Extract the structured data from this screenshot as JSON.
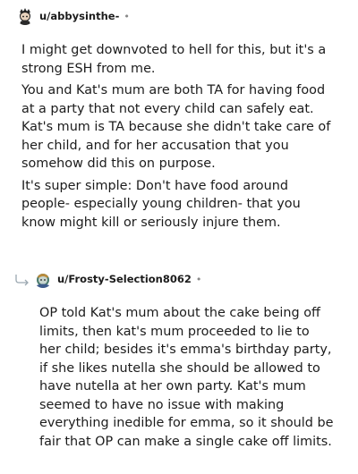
{
  "comment1": {
    "username": "u/abbysinthe-",
    "separator": "•",
    "paragraphs": [
      "I might get downvoted to hell for this, but it's a strong ESH from me.",
      "You and Kat's mum are both TA for having food at a party that not every child can safely eat. Kat's mum is TA because she didn't take care of her child, and for her accusation that you somehow did this on purpose.",
      "It's super simple: Don't have food around people- especially young children- that you know might kill or seriously injure them."
    ]
  },
  "comment2": {
    "username": "u/Frosty-Selection8062",
    "separator": "•",
    "paragraphs": [
      "OP told Kat's mum about the cake being off limits, then kat's mum proceeded to lie to her child; besides it's emma's birthday party, if she likes nutella she should be allowed to have nutella at her own party. Kat's mum seemed to have no issue with making everything inedible for emma, so it should be fair that OP can make a single cake off limits."
    ]
  }
}
